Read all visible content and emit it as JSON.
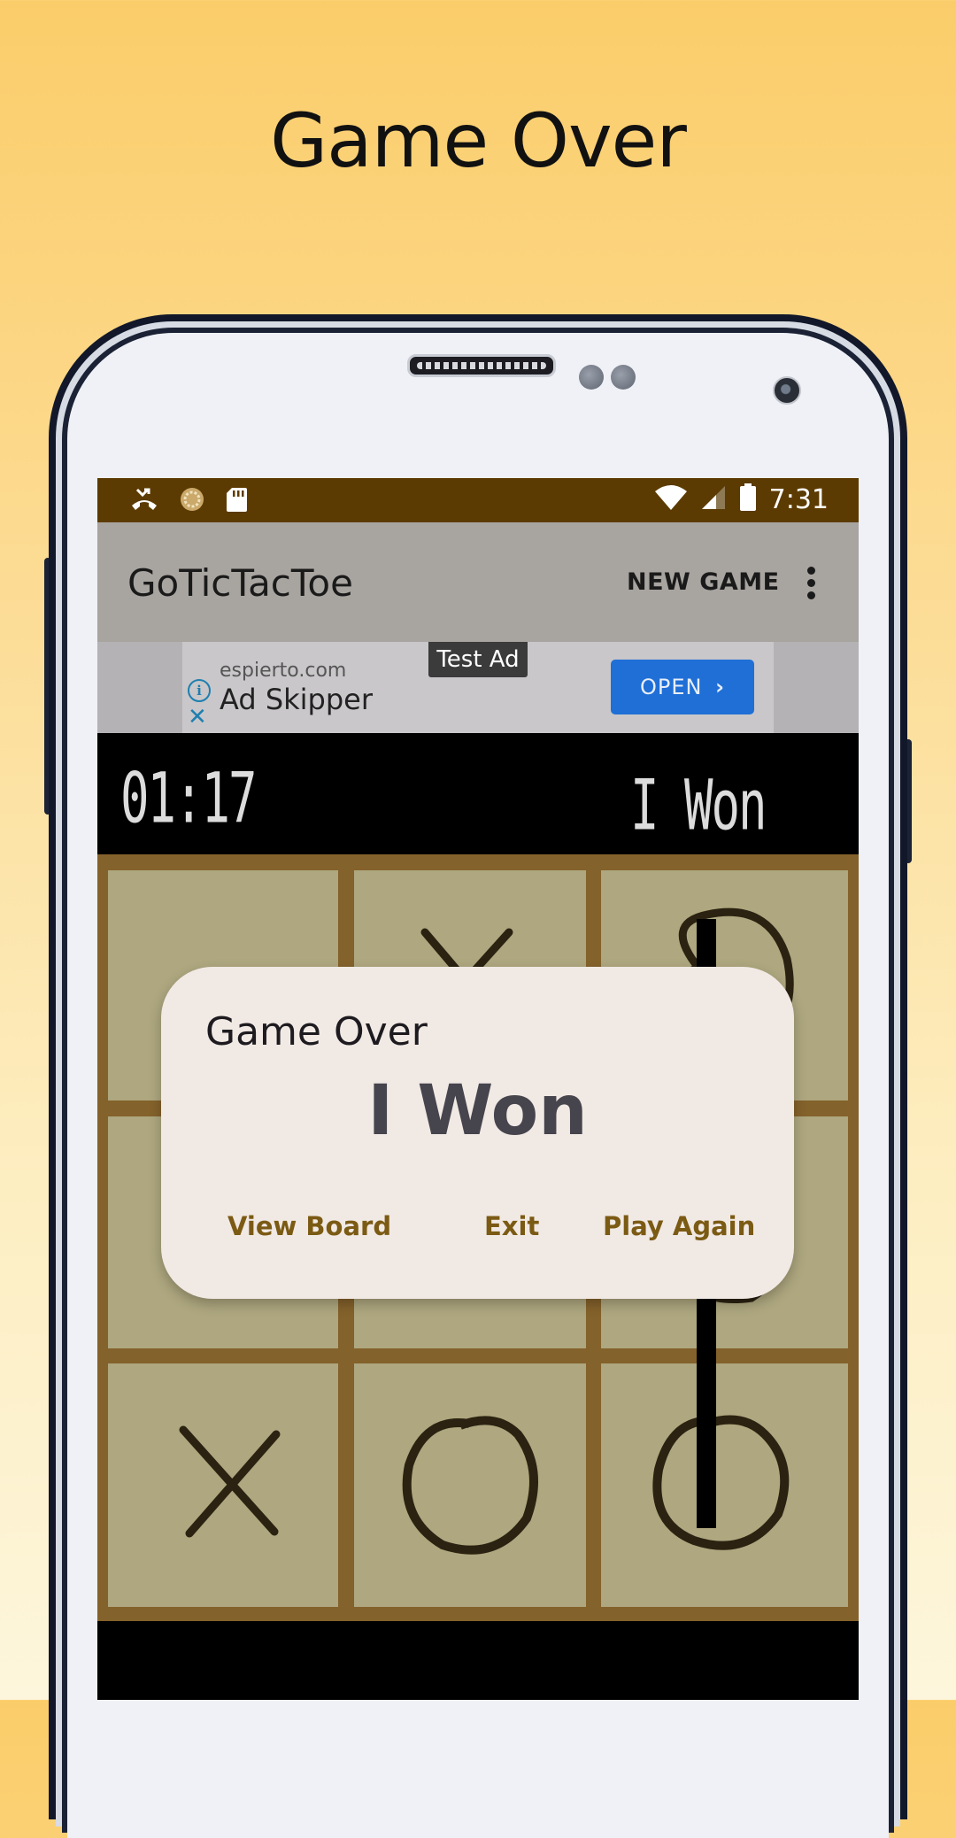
{
  "headline": "Game Over",
  "status_bar": {
    "time": "7:31",
    "left_icons": [
      "missed-call-icon",
      "sync-icon",
      "sd-card-icon"
    ],
    "right_icons": [
      "wifi-icon",
      "signal-icon",
      "battery-icon"
    ],
    "color": "#5c3b02"
  },
  "app_bar": {
    "title": "GoTicTacToe",
    "new_game_label": "NEW GAME",
    "overflow_icon": "more-vert-icon"
  },
  "ad": {
    "label": "Test Ad",
    "domain": "espierto.com",
    "name": "Ad Skipper",
    "open_label": "OPEN",
    "open_icon": "chevron-right-icon",
    "info_icon": "info-icon",
    "close_icon": "close-icon",
    "button_color": "#1f6fd6"
  },
  "game": {
    "timer": "01:17",
    "status": "I Won",
    "board": [
      [
        "",
        "X",
        "O"
      ],
      [
        "",
        "",
        "O"
      ],
      [
        "X",
        "O",
        "O"
      ]
    ],
    "winning_line": "right-column",
    "board_color": "#aea77f",
    "grid_color": "#84622b"
  },
  "dialog": {
    "title": "Game Over",
    "result": "I Won",
    "buttons": {
      "view_board": "View Board",
      "exit": "Exit",
      "play_again": "Play Again"
    },
    "button_color": "#7b5a14"
  }
}
